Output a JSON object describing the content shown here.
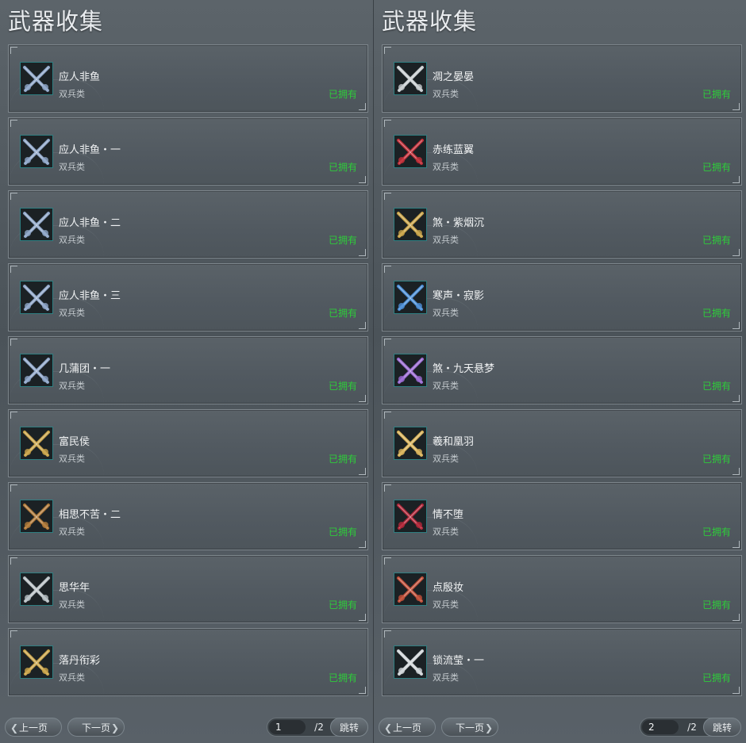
{
  "left": {
    "title": "武器收集",
    "items": [
      {
        "name": "应人非鱼",
        "type": "双兵类",
        "status": "已拥有",
        "icon": "twin-blade-silver-icon",
        "color": "#8fa6c8"
      },
      {
        "name": "应人非鱼・一",
        "type": "双兵类",
        "status": "已拥有",
        "icon": "twin-blade-silver-icon",
        "color": "#8fa6c8"
      },
      {
        "name": "应人非鱼・二",
        "type": "双兵类",
        "status": "已拥有",
        "icon": "twin-blade-silver-icon",
        "color": "#8fa6c8"
      },
      {
        "name": "应人非鱼・三",
        "type": "双兵类",
        "status": "已拥有",
        "icon": "twin-blade-silver-icon",
        "color": "#8fa6c8"
      },
      {
        "name": "几蒲团・一",
        "type": "双兵类",
        "status": "已拥有",
        "icon": "twin-blade-silver-icon",
        "color": "#8fa6c8"
      },
      {
        "name": "富民侯",
        "type": "双兵类",
        "status": "已拥有",
        "icon": "twin-blade-gold-icon",
        "color": "#c9a44a"
      },
      {
        "name": "相思不苦・二",
        "type": "双兵类",
        "status": "已拥有",
        "icon": "twin-blade-bronze-icon",
        "color": "#b07a3a"
      },
      {
        "name": "思华年",
        "type": "双兵类",
        "status": "已拥有",
        "icon": "twin-blade-steel-icon",
        "color": "#b8c0c4"
      },
      {
        "name": "落丹衔彩",
        "type": "双兵类",
        "status": "已拥有",
        "icon": "twin-blade-gold-icon",
        "color": "#c9a44a"
      }
    ],
    "prev_label": "上一页",
    "next_label": "下一页",
    "page": "1",
    "total": "/2",
    "jump_label": "跳转"
  },
  "right": {
    "title": "武器收集",
    "items": [
      {
        "name": "凋之晏晏",
        "type": "双兵类",
        "status": "已拥有",
        "icon": "twin-blade-steel-icon",
        "color": "#c8cdd0"
      },
      {
        "name": "赤练蓝翼",
        "type": "双兵类",
        "status": "已拥有",
        "icon": "twin-blade-crimson-icon",
        "color": "#c0303a"
      },
      {
        "name": "煞・紫烟沉",
        "type": "双兵类",
        "status": "已拥有",
        "icon": "twin-blade-dark-icon",
        "color": "#c9a44a"
      },
      {
        "name": "寒声・寂影",
        "type": "双兵类",
        "status": "已拥有",
        "icon": "twin-blade-blue-icon",
        "color": "#4d8fd6"
      },
      {
        "name": "煞・九天悬梦",
        "type": "双兵类",
        "status": "已拥有",
        "icon": "twin-blade-purple-icon",
        "color": "#9a6ad0"
      },
      {
        "name": "羲和凰羽",
        "type": "双兵类",
        "status": "已拥有",
        "icon": "twin-blade-gold-icon",
        "color": "#d8b25a"
      },
      {
        "name": "情不堕",
        "type": "双兵类",
        "status": "已拥有",
        "icon": "twin-blade-crimson-icon",
        "color": "#b0283a"
      },
      {
        "name": "点殷妆",
        "type": "双兵类",
        "status": "已拥有",
        "icon": "twin-blade-crimson-icon",
        "color": "#c0503a"
      },
      {
        "name": "锁流莹・一",
        "type": "双兵类",
        "status": "已拥有",
        "icon": "twin-blade-steel-icon",
        "color": "#d0d5d8"
      }
    ],
    "prev_label": "上一页",
    "next_label": "下一页",
    "page": "2",
    "total": "/2",
    "jump_label": "跳转"
  },
  "colors": {
    "owned": "#2ecc3a",
    "icon_border": "#2f7f82"
  }
}
